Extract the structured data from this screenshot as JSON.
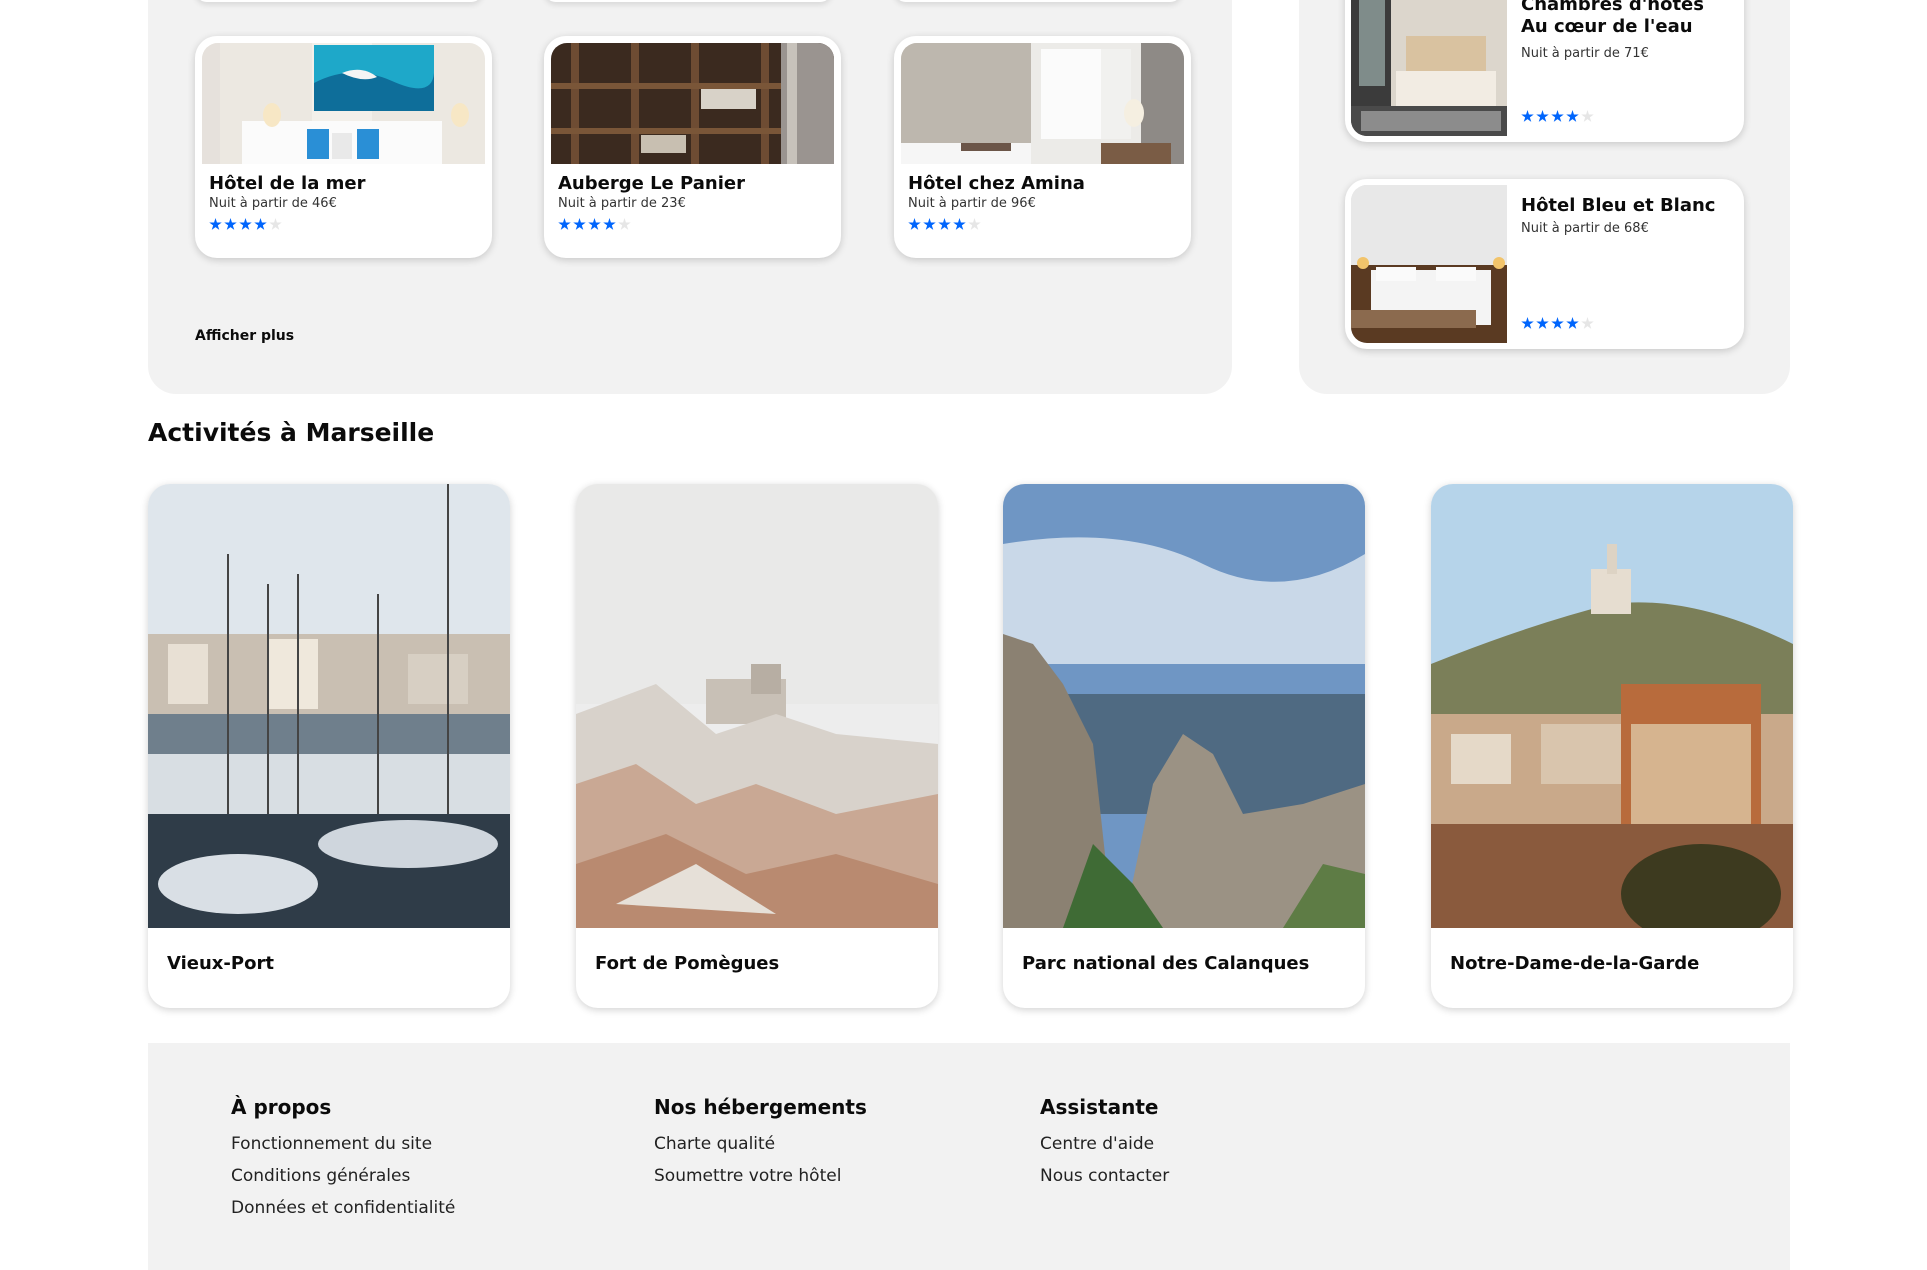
{
  "hotels": {
    "more_label": "Afficher plus",
    "items": [
      {
        "name": "Hôtel de la mer",
        "price": "Nuit à partir de 46€",
        "rating": 4
      },
      {
        "name": "Auberge Le Panier",
        "price": "Nuit à partir de 23€",
        "rating": 4
      },
      {
        "name": "Hôtel chez Amina",
        "price": "Nuit à partir de 96€",
        "rating": 4
      }
    ]
  },
  "popular": {
    "items": [
      {
        "name": "Chambres d'hôtes Au cœur de l'eau",
        "price": "Nuit à partir de 71€",
        "rating": 4
      },
      {
        "name": "Hôtel Bleu et Blanc",
        "price": "Nuit à partir de 68€",
        "rating": 4
      }
    ]
  },
  "activities": {
    "title": "Activités à Marseille",
    "items": [
      {
        "label": "Vieux-Port"
      },
      {
        "label": "Fort de Pomègues"
      },
      {
        "label": "Parc national des Calanques"
      },
      {
        "label": "Notre-Dame-de-la-Garde"
      }
    ]
  },
  "footer": {
    "columns": [
      {
        "title": "À propos",
        "links": [
          "Fonctionnement du site",
          "Conditions générales",
          "Données et confidentialité"
        ]
      },
      {
        "title": "Nos hébergements",
        "links": [
          "Charte qualité",
          "Soumettre votre hôtel"
        ]
      },
      {
        "title": "Assistante",
        "links": [
          "Centre d'aide",
          "Nous contacter"
        ]
      }
    ]
  },
  "colors": {
    "accent": "#0065fc",
    "panel": "#f2f2f2"
  }
}
